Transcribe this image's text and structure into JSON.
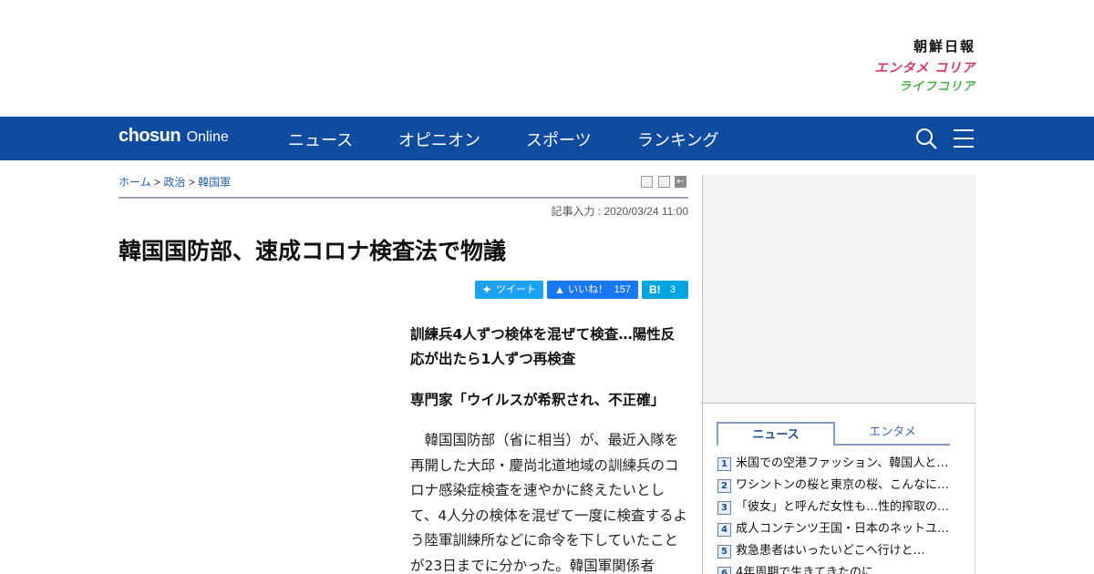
{
  "brands": {
    "chosun": "朝鮮日報",
    "entame": "エンタメ コリア",
    "life": "ライフコリア"
  },
  "nav": {
    "logo_main": "chosun",
    "logo_sub": "Online",
    "items": [
      "ニュース",
      "オピニオン",
      "スポーツ",
      "ランキング"
    ],
    "bg_color": "#0f4b9f"
  },
  "breadcrumb": {
    "home": "ホーム",
    "category": "政治",
    "subcategory": "韓国軍",
    "separator": ">"
  },
  "article": {
    "date": "記事入力 : 2020/03/24 11:00",
    "headline": "韓国国防部、速成コロナ検査法で物議",
    "lead1": "訓練兵4人ずつ検体を混ぜて検査…陽性反応が出たら1人ずつ再検査",
    "lead2": "専門家「ウイルスが希釈され、不正確」",
    "body": "韓国国防部（省に相当）が、最近入隊を再開した大邱・慶尚北道地域の訓練兵のコロナ感染症検査を速やかに終えたいとして、4人分の検体を混ぜて一度に検査するよう陸軍訓練所などに命令を下していたことが23日までに分かった。韓国軍関係者"
  },
  "share": {
    "tweet_label": "ツイート",
    "like_label": "いいね！",
    "like_count": "157",
    "hatena_label": "B!",
    "hatena_count": "3"
  },
  "sidebar": {
    "tabs": [
      "ニュース",
      "エンタメ"
    ],
    "ranking": [
      {
        "num": "1",
        "text": "米国での空港ファッション、韓国人と…"
      },
      {
        "num": "2",
        "text": "ワシントンの桜と東京の桜、こんなに…"
      },
      {
        "num": "3",
        "text": "「彼女」と呼んだ女性も…性的搾取の…"
      },
      {
        "num": "4",
        "text": "成人コンテンツ王国・日本のネットユ…"
      },
      {
        "num": "5",
        "text": "救急患者はいったいどこへ行けと…"
      },
      {
        "num": "6",
        "text": "4年周期で生きてきたのに…"
      }
    ]
  }
}
